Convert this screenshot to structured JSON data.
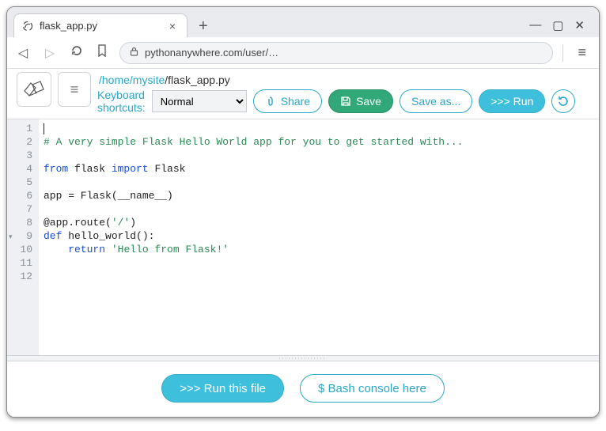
{
  "browser": {
    "tab_title": "flask_app.py",
    "url_display": "pythonanywhere.com/user/…"
  },
  "breadcrumb": {
    "seg_home": "/home",
    "seg_mysite": "/mysite",
    "seg_file": "/flask_app.py"
  },
  "toolbar": {
    "kb_line1": "Keyboard",
    "kb_line2": "shortcuts:",
    "mode_selected": "Normal",
    "share_label": "Share",
    "save_label": "Save",
    "saveas_label": "Save as...",
    "run_label": ">>> Run"
  },
  "editor": {
    "lines": [
      "",
      "# A very simple Flask Hello World app for you to get started with...",
      "",
      "from flask import Flask",
      "",
      "app = Flask(__name__)",
      "",
      "@app.route('/')",
      "def hello_world():",
      "    return 'Hello from Flask!'",
      "",
      ""
    ],
    "line_numbers": [
      "1",
      "2",
      "3",
      "4",
      "5",
      "6",
      "7",
      "8",
      "9",
      "10",
      "11",
      "12"
    ],
    "fold_at_line": 9
  },
  "footer": {
    "run_file": ">>> Run this file",
    "bash_here": "$ Bash console here"
  },
  "icons": {
    "share": "attach",
    "save": "floppy",
    "refresh": "refresh"
  }
}
